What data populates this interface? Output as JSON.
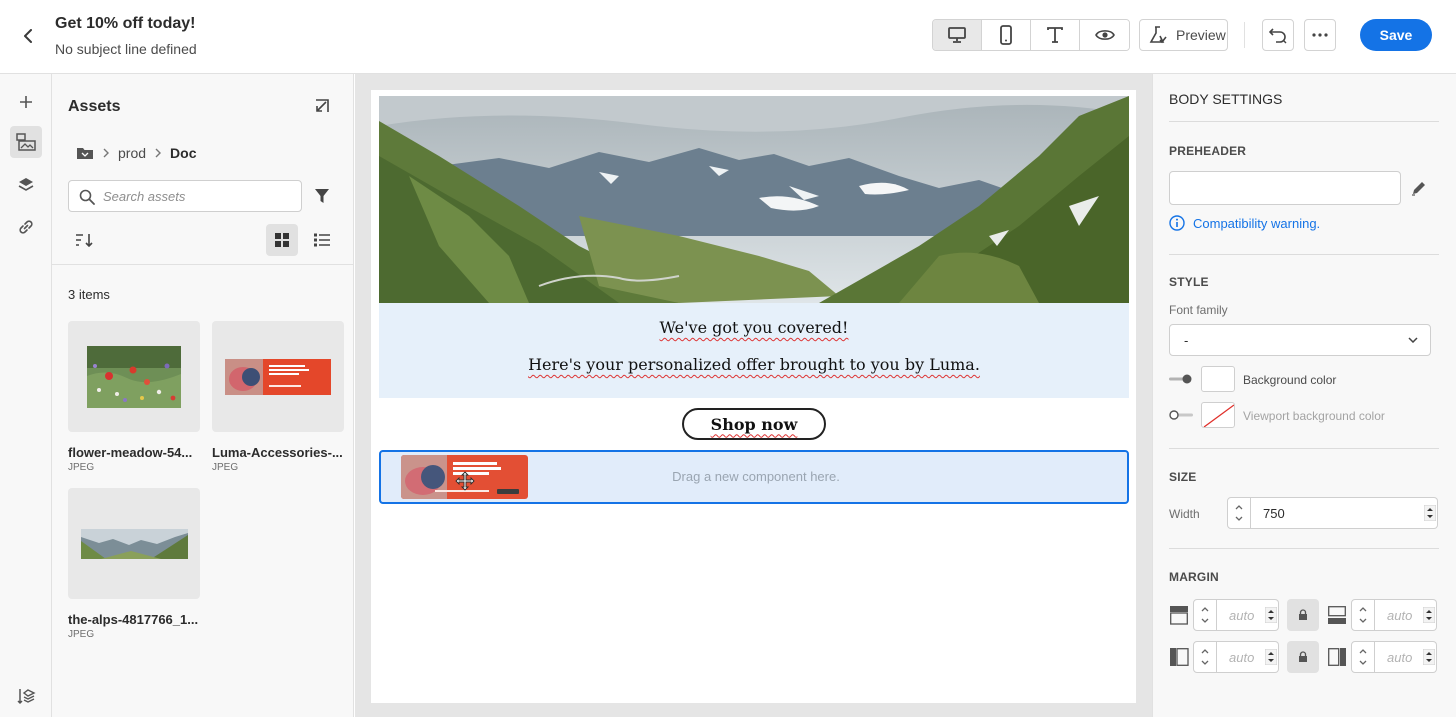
{
  "header": {
    "title": "Get 10% off today!",
    "subtitle": "No subject line defined",
    "preview_label": "Preview",
    "save_label": "Save"
  },
  "assets": {
    "title": "Assets",
    "breadcrumb": [
      "prod",
      "Doc"
    ],
    "search_placeholder": "Search assets",
    "item_count": "3 items",
    "items": [
      {
        "name": "flower-meadow-54...",
        "type": "JPEG"
      },
      {
        "name": "Luma-Accessories-...",
        "type": "JPEG"
      },
      {
        "name": "the-alps-4817766_1...",
        "type": "JPEG"
      }
    ]
  },
  "email": {
    "heading": "We've got you covered!",
    "body": "Here's your personalized offer brought to you by Luma.",
    "button_label": "Shop now",
    "dropzone_text": "Drag a new component here."
  },
  "settings": {
    "title": "BODY SETTINGS",
    "preheader_label": "PREHEADER",
    "compat_warning": "Compatibility warning.",
    "style_label": "STYLE",
    "font_family_label": "Font family",
    "font_family_value": "-",
    "bg_color_label": "Background color",
    "viewport_bg_label": "Viewport background color",
    "size_label": "SIZE",
    "width_label": "Width",
    "width_value": "750",
    "margin_label": "MARGIN",
    "margin_placeholder": "auto"
  },
  "colors": {
    "accent": "#1473e6",
    "text_block_bg": "#e6f0fa",
    "canvas_bg": "#e5e5e5"
  }
}
